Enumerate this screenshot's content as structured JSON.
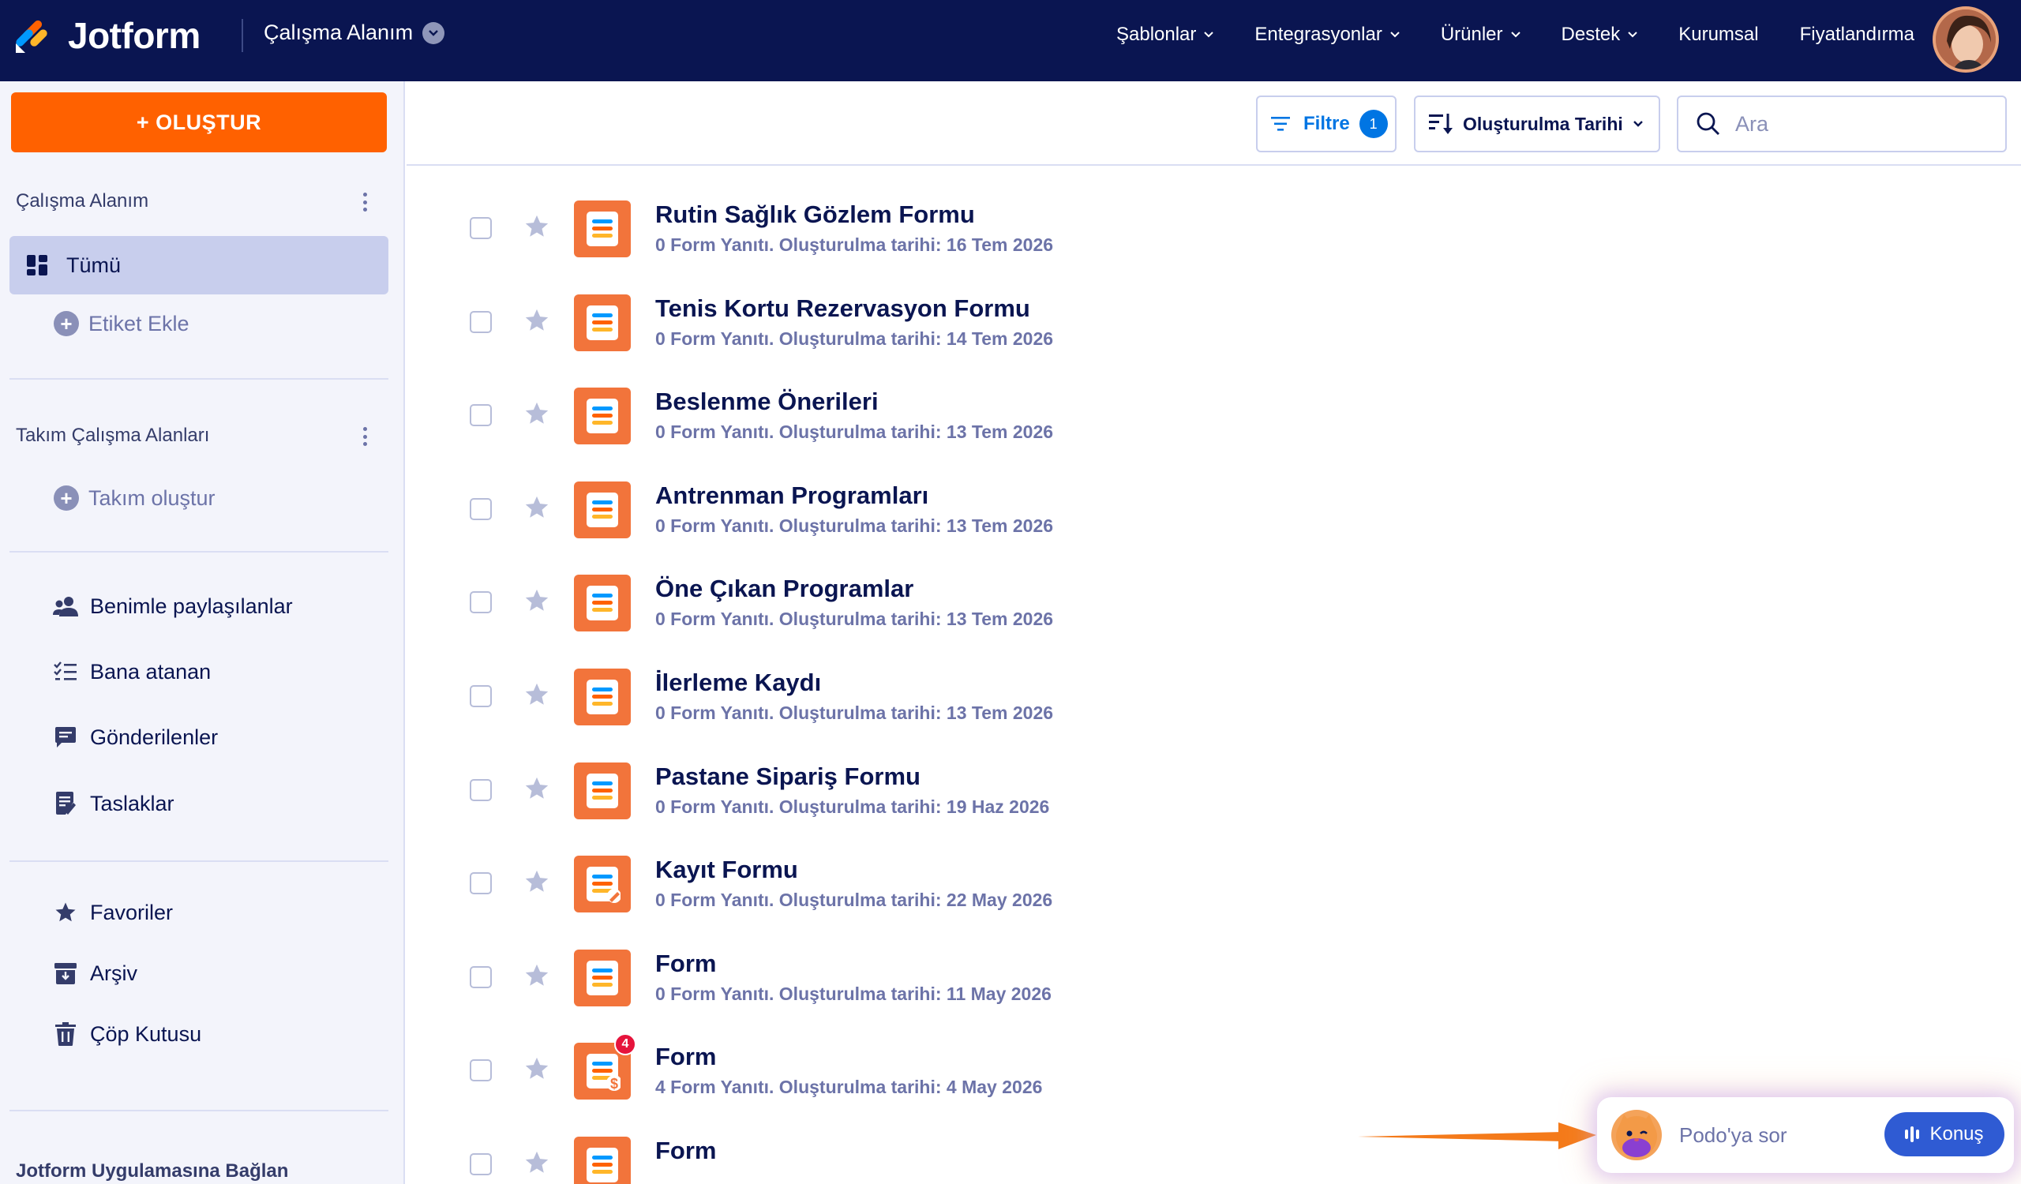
{
  "brand": {
    "name": "Jotform"
  },
  "workspace_switch": {
    "label": "Çalışma Alanım"
  },
  "nav": {
    "items": [
      {
        "label": "Şablonlar",
        "has_menu": true
      },
      {
        "label": "Entegrasyonlar",
        "has_menu": true
      },
      {
        "label": "Ürünler",
        "has_menu": true
      },
      {
        "label": "Destek",
        "has_menu": true
      },
      {
        "label": "Kurumsal",
        "has_menu": false
      },
      {
        "label": "Fiyatlandırma",
        "has_menu": false
      }
    ]
  },
  "sidebar": {
    "create_label": "+ OLUŞTUR",
    "workspace_title": "Çalışma Alanım",
    "all_label": "Tümü",
    "add_tag_label": "Etiket Ekle",
    "team_title": "Takım Çalışma Alanları",
    "create_team_label": "Takım oluştur",
    "links": [
      {
        "label": "Benimle paylaşılanlar",
        "icon": "people-icon"
      },
      {
        "label": "Bana atanan",
        "icon": "checklist-icon"
      },
      {
        "label": "Gönderilenler",
        "icon": "message-icon"
      },
      {
        "label": "Taslaklar",
        "icon": "draft-icon"
      }
    ],
    "links2": [
      {
        "label": "Favoriler",
        "icon": "star-icon"
      },
      {
        "label": "Arşiv",
        "icon": "archive-icon"
      },
      {
        "label": "Çöp Kutusu",
        "icon": "trash-icon"
      }
    ],
    "footer_label": "Jotform Uygulamasına Bağlan"
  },
  "toolbar": {
    "filter_label": "Filtre",
    "filter_count": "1",
    "sort_label": "Oluşturulma Tarihi",
    "search_placeholder": "Ara"
  },
  "forms": [
    {
      "title": "Rutin Sağlık Gözlem Formu",
      "meta": "0 Form Yanıtı. Oluşturulma tarihi: 16 Tem 2026",
      "variant": "form"
    },
    {
      "title": "Tenis Kortu Rezervasyon Formu",
      "meta": "0 Form Yanıtı. Oluşturulma tarihi: 14 Tem 2026",
      "variant": "form"
    },
    {
      "title": "Beslenme Önerileri",
      "meta": "0 Form Yanıtı. Oluşturulma tarihi: 13 Tem 2026",
      "variant": "form"
    },
    {
      "title": "Antrenman Programları",
      "meta": "0 Form Yanıtı. Oluşturulma tarihi: 13 Tem 2026",
      "variant": "form"
    },
    {
      "title": "Öne Çıkan Programlar",
      "meta": "0 Form Yanıtı. Oluşturulma tarihi: 13 Tem 2026",
      "variant": "form"
    },
    {
      "title": "İlerleme Kaydı",
      "meta": "0 Form Yanıtı. Oluşturulma tarihi: 13 Tem 2026",
      "variant": "form"
    },
    {
      "title": "Pastane Sipariş Formu",
      "meta": "0 Form Yanıtı. Oluşturulma tarihi: 19 Haz 2026",
      "variant": "form"
    },
    {
      "title": "Kayıt Formu",
      "meta": "0 Form Yanıtı. Oluşturulma tarihi: 22 May 2026",
      "variant": "signature"
    },
    {
      "title": "Form",
      "meta": "0 Form Yanıtı. Oluşturulma tarihi: 11 May 2026",
      "variant": "form"
    },
    {
      "title": "Form",
      "meta": "4 Form Yanıtı. Oluşturulma tarihi: 4 May 2026",
      "variant": "payment",
      "badge": "4"
    },
    {
      "title": "Form",
      "meta": "",
      "variant": "form"
    }
  ],
  "podo": {
    "prompt": "Podo'ya sor",
    "talk_label": "Konuş"
  },
  "colors": {
    "nav_bg": "#0a1551",
    "accent_orange": "#ff6100",
    "form_icon": "#f2743b",
    "link_blue": "#0075e3",
    "talk_button": "#2f5bd3"
  }
}
